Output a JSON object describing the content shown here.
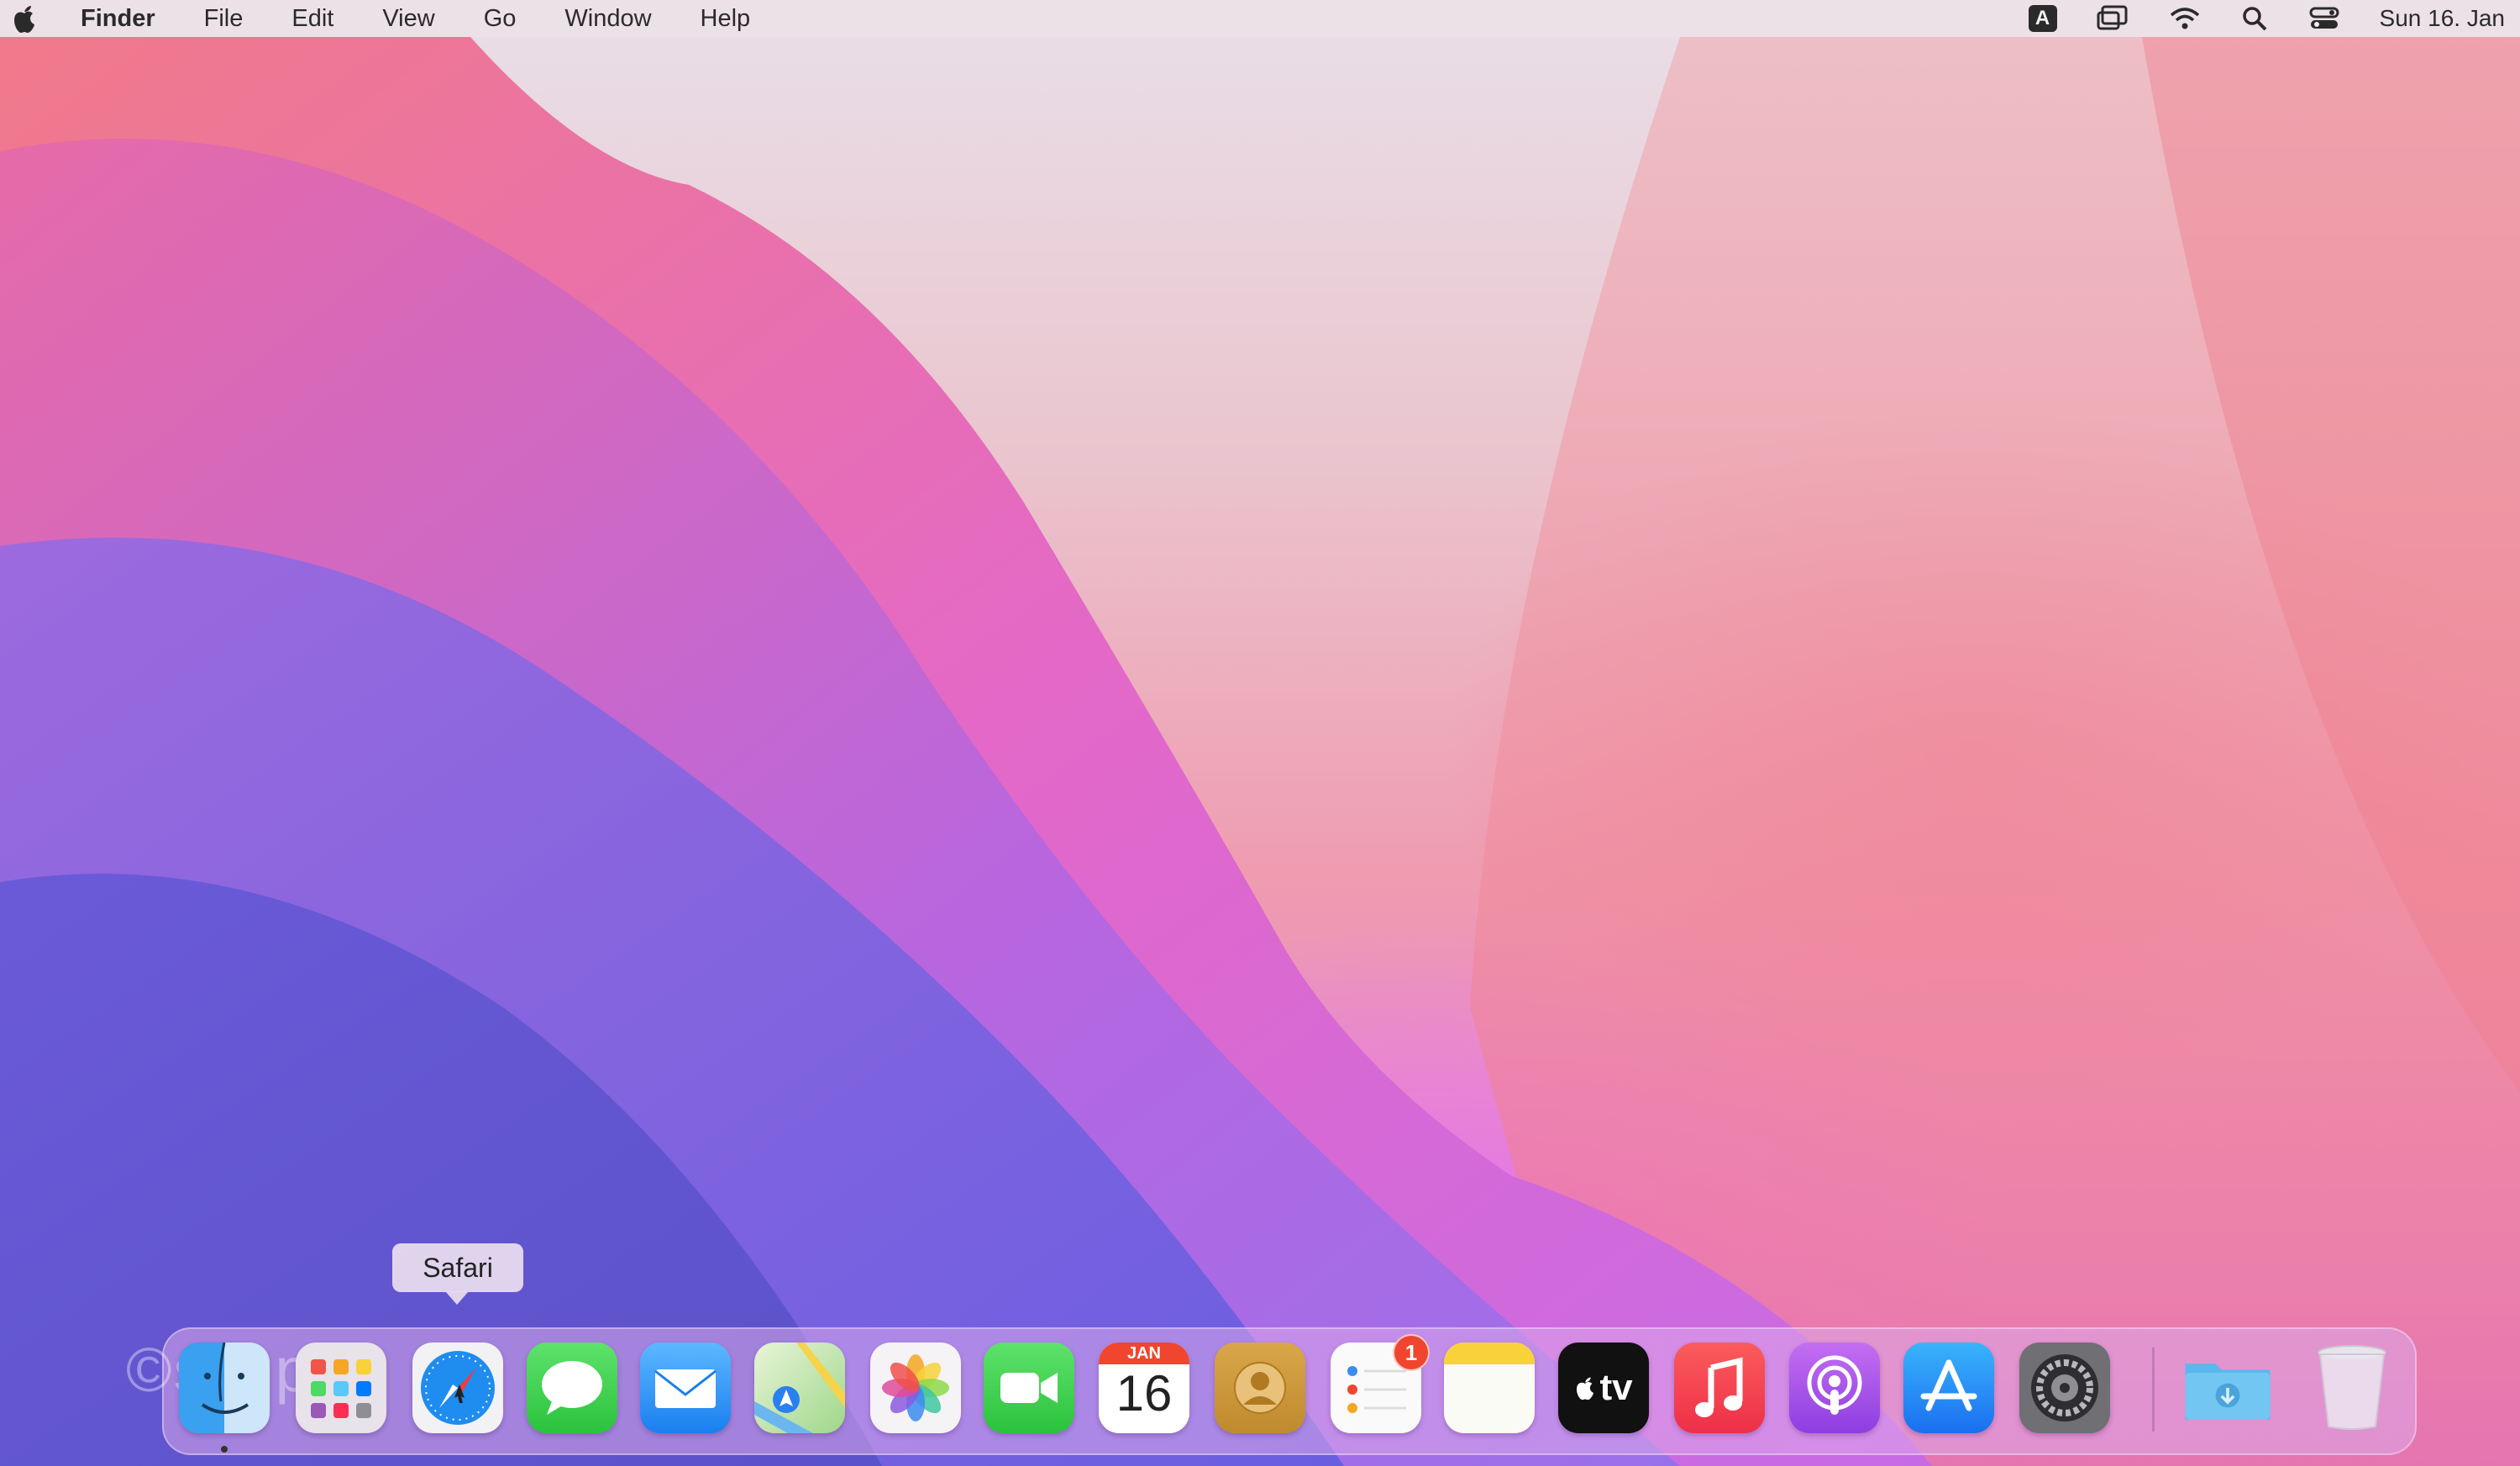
{
  "menubar": {
    "apple_icon": "apple-logo-icon",
    "app_name": "Finder",
    "menus": [
      "File",
      "Edit",
      "View",
      "Go",
      "Window",
      "Help"
    ],
    "input_source": "A",
    "clock": "Sun 16. Jan"
  },
  "tooltip": {
    "text": "Safari"
  },
  "watermark": "©simplig",
  "dock": {
    "apps": [
      {
        "name": "Finder",
        "icon": "finder-icon",
        "running": true
      },
      {
        "name": "Launchpad",
        "icon": "launchpad-icon"
      },
      {
        "name": "Safari",
        "icon": "safari-icon"
      },
      {
        "name": "Messages",
        "icon": "messages-icon"
      },
      {
        "name": "Mail",
        "icon": "mail-icon"
      },
      {
        "name": "Maps",
        "icon": "maps-icon"
      },
      {
        "name": "Photos",
        "icon": "photos-icon"
      },
      {
        "name": "FaceTime",
        "icon": "facetime-icon"
      },
      {
        "name": "Calendar",
        "icon": "calendar-icon",
        "month": "JAN",
        "day": "16"
      },
      {
        "name": "Contacts",
        "icon": "contacts-icon"
      },
      {
        "name": "Reminders",
        "icon": "reminders-icon",
        "badge": "1"
      },
      {
        "name": "Notes",
        "icon": "notes-icon"
      },
      {
        "name": "TV",
        "icon": "apple-tv-icon",
        "label": "tv"
      },
      {
        "name": "Music",
        "icon": "music-icon"
      },
      {
        "name": "Podcasts",
        "icon": "podcasts-icon"
      },
      {
        "name": "App Store",
        "icon": "app-store-icon"
      },
      {
        "name": "System Preferences",
        "icon": "system-preferences-icon"
      },
      {
        "name": "Downloads",
        "icon": "downloads-folder-icon"
      },
      {
        "name": "Trash",
        "icon": "trash-icon"
      }
    ]
  },
  "colors": {
    "menubar_bg": "#eee2e8",
    "dock_bg": "#dcaaeb",
    "badge_red": "#f0452f"
  }
}
